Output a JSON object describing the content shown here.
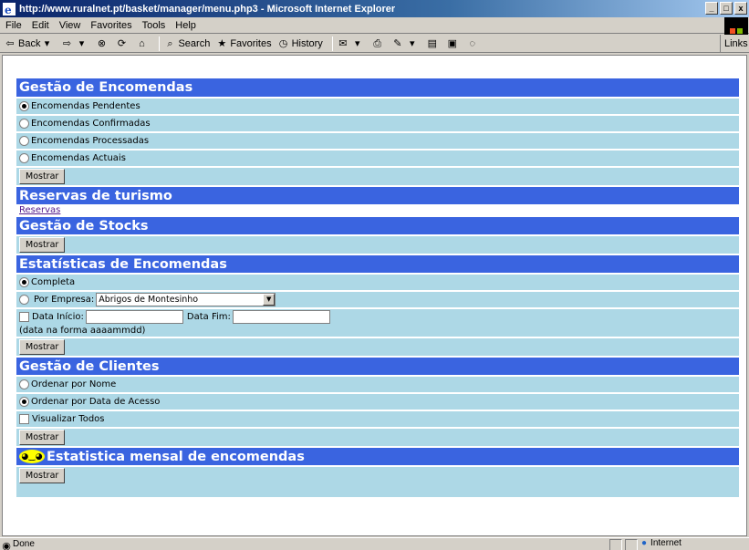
{
  "window": {
    "title": "http://www.ruralnet.pt/basket/manager/menu.php3 - Microsoft Internet Explorer",
    "controls": [
      "_",
      "□",
      "x"
    ]
  },
  "menubar": {
    "items": [
      {
        "label": "File"
      },
      {
        "label": "Edit"
      },
      {
        "label": "View"
      },
      {
        "label": "Favorites"
      },
      {
        "label": "Tools"
      },
      {
        "label": "Help"
      }
    ]
  },
  "toolbar": {
    "back": "Back",
    "search": "Search",
    "favorites": "Favorites",
    "history": "History",
    "links": "Links"
  },
  "sections": {
    "encomendas": {
      "title": "Gestão de Encomendas",
      "options": [
        {
          "label": "Encomendas Pendentes",
          "checked": true
        },
        {
          "label": "Encomendas Confirmadas",
          "checked": false
        },
        {
          "label": "Encomendas Processadas",
          "checked": false
        },
        {
          "label": "Encomendas Actuais",
          "checked": false
        }
      ],
      "button": "Mostrar"
    },
    "turismo": {
      "title": "Reservas de turismo",
      "link": "Reservas"
    },
    "stocks": {
      "title": "Gestão de Stocks",
      "button": "Mostrar"
    },
    "estatisticas": {
      "title": "Estatísticas de Encomendas",
      "completa": "Completa",
      "por_empresa": "Por Empresa:",
      "empresa_selected": "Abrigos de Montesinho",
      "data_inicio": "Data Início:",
      "data_fim": "Data Fim:",
      "format_note": "(data na forma aaaammdd)",
      "button": "Mostrar"
    },
    "clientes": {
      "title": "Gestão de Clientes",
      "options": [
        {
          "label": "Ordenar por Nome",
          "checked": false
        },
        {
          "label": "Ordenar por Data de Acesso",
          "checked": true
        }
      ],
      "visualizar": "Visualizar Todos",
      "button": "Mostrar"
    },
    "mensal": {
      "title": "Estatistica mensal de encomendas",
      "button": "Mostrar"
    }
  },
  "status": {
    "left": "Done",
    "zone": "Internet"
  },
  "colors": {
    "header_bg": "#3a64e0",
    "row_bg": "#add8e6",
    "title_bar": "#0a246a"
  }
}
